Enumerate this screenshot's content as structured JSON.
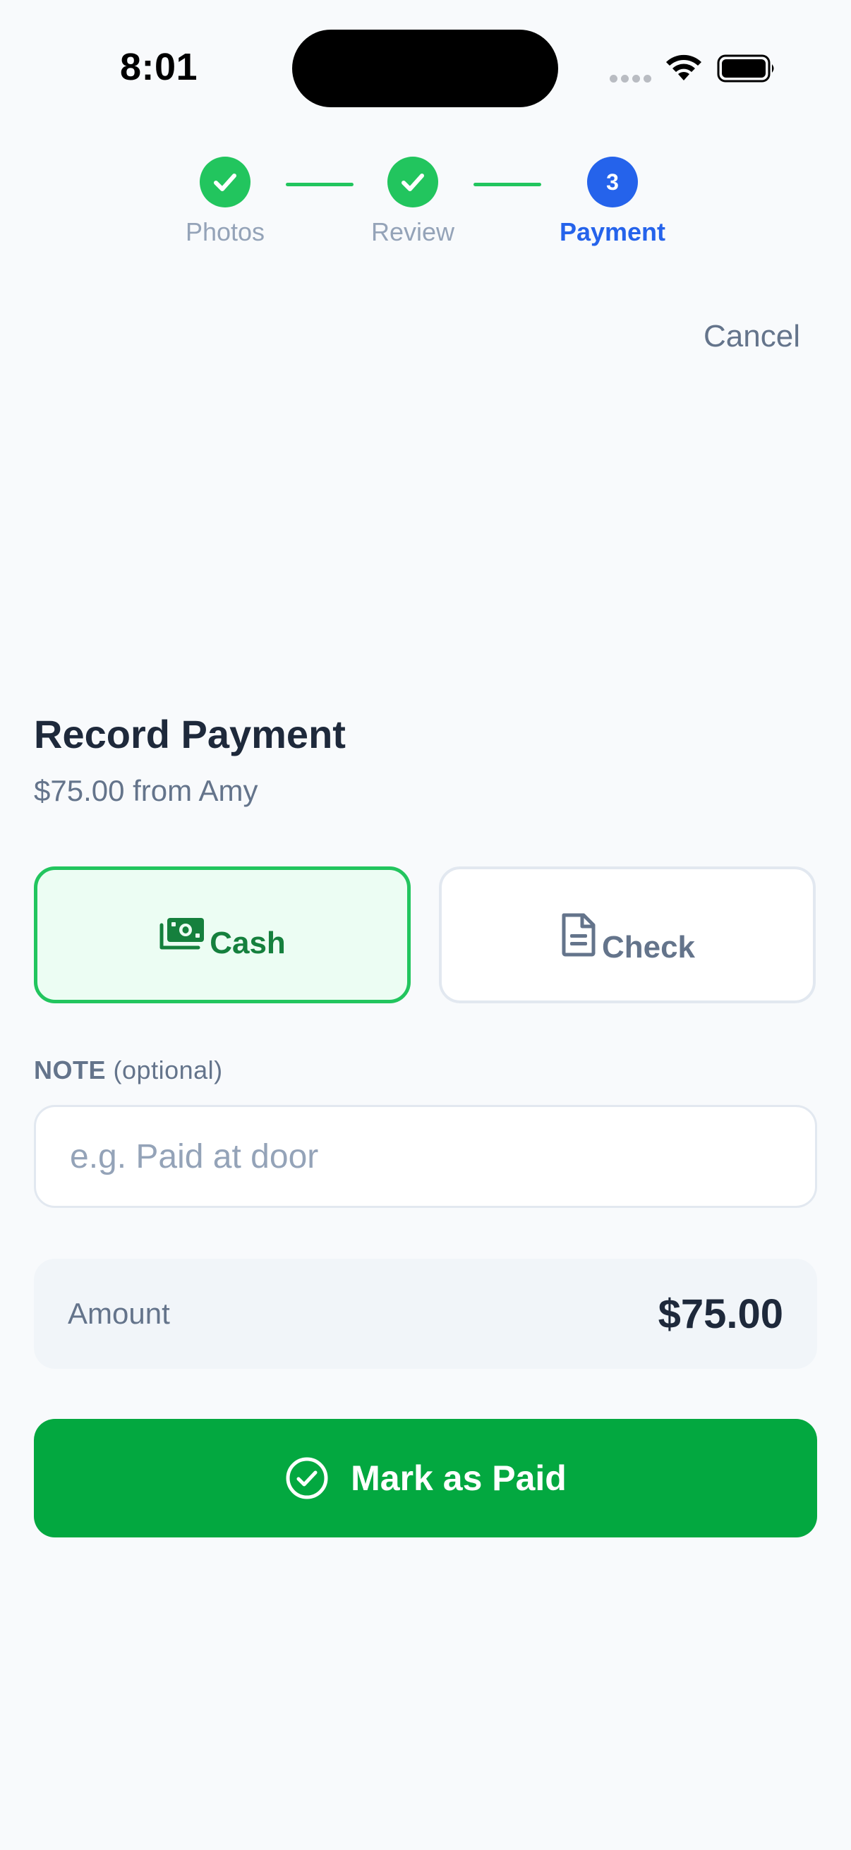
{
  "status_bar": {
    "time": "8:01"
  },
  "stepper": {
    "steps": [
      {
        "label": "Photos",
        "state": "done"
      },
      {
        "label": "Review",
        "state": "done"
      },
      {
        "label": "Payment",
        "state": "current",
        "number": "3"
      }
    ]
  },
  "header": {
    "cancel_label": "Cancel"
  },
  "payment": {
    "title": "Record Payment",
    "subtitle": "$75.00 from Amy",
    "methods": [
      {
        "label": "Cash",
        "icon": "cash-icon",
        "selected": true
      },
      {
        "label": "Check",
        "icon": "document-icon",
        "selected": false
      }
    ],
    "note": {
      "label": "NOTE",
      "label_suffix": "(optional)",
      "placeholder": "e.g. Paid at door",
      "value": ""
    },
    "amount": {
      "label": "Amount",
      "value": "$75.00"
    },
    "submit_label": "Mark as Paid"
  },
  "colors": {
    "accent_green": "#22c55e",
    "button_green": "#03a840",
    "accent_blue": "#2563eb",
    "cash_selected_bg": "#ecfdf3",
    "page_bg": "#f8fafc"
  }
}
